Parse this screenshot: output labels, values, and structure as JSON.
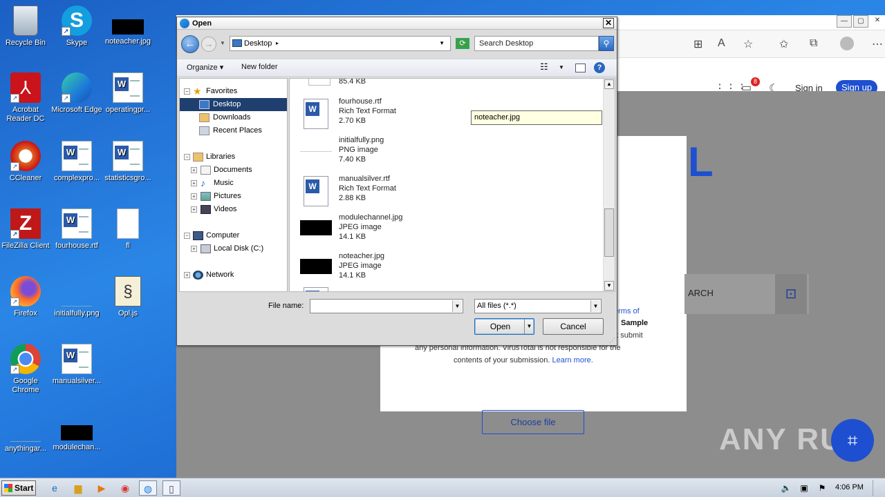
{
  "desktop": {
    "icons": [
      {
        "label": "Recycle Bin"
      },
      {
        "label": "Skype"
      },
      {
        "label": "noteacher.jpg"
      },
      {
        "label": "Acrobat Reader DC"
      },
      {
        "label": "Microsoft Edge"
      },
      {
        "label": "operatingpr..."
      },
      {
        "label": "CCleaner"
      },
      {
        "label": "complexpro..."
      },
      {
        "label": "statisticsgro..."
      },
      {
        "label": "FileZilla Client"
      },
      {
        "label": "fourhouse.rtf"
      },
      {
        "label": "fl"
      },
      {
        "label": "Firefox"
      },
      {
        "label": "initialfully.png"
      },
      {
        "label": "Opl.js"
      },
      {
        "label": "Google Chrome"
      },
      {
        "label": "manualsilver..."
      },
      {
        "label": "anythingar..."
      },
      {
        "label": "modulechan..."
      }
    ]
  },
  "browser": {
    "sign_in": "Sign in",
    "sign_up": "Sign up",
    "notification_count": "8",
    "big_letter": "L",
    "search_partial": "ARCH",
    "terms_text_1": "erms of",
    "terms_text_2": "Sample",
    "terms_text_3": "ot submit",
    "terms_line_4": "any personal information. VirusTotal is not responsible for the",
    "terms_line_5": "contents of your submission.",
    "learn_more": "Learn more.",
    "choose_file": "Choose file",
    "watermark": "ANY RUN"
  },
  "dialog": {
    "title": "Open",
    "close": "✕",
    "path": "Desktop",
    "search_placeholder": "Search Desktop",
    "organize": "Organize",
    "new_folder": "New folder",
    "nav": [
      {
        "label": "Favorites"
      },
      {
        "label": "Desktop"
      },
      {
        "label": "Downloads"
      },
      {
        "label": "Recent Places"
      },
      {
        "label": "Libraries"
      },
      {
        "label": "Documents"
      },
      {
        "label": "Music"
      },
      {
        "label": "Pictures"
      },
      {
        "label": "Videos"
      },
      {
        "label": "Computer"
      },
      {
        "label": "Local Disk (C:)"
      },
      {
        "label": "Network"
      }
    ],
    "files": [
      {
        "name": "",
        "type": "",
        "size": "85.4 KB"
      },
      {
        "name": "fourhouse.rtf",
        "type": "Rich Text Format",
        "size": "2.70 KB"
      },
      {
        "name": "initialfully.png",
        "type": "PNG image",
        "size": "7.40 KB"
      },
      {
        "name": "manualsilver.rtf",
        "type": "Rich Text Format",
        "size": "2.88 KB"
      },
      {
        "name": "modulechannel.jpg",
        "type": "JPEG image",
        "size": "14.1 KB"
      },
      {
        "name": "noteacher.jpg",
        "type": "JPEG image",
        "size": "14.1 KB"
      }
    ],
    "tooltip": "noteacher.jpg",
    "file_name_label": "File name:",
    "file_name_value": "",
    "file_type": "All files (*.*)",
    "open_button": "Open",
    "cancel_button": "Cancel"
  },
  "taskbar": {
    "start": "Start",
    "clock": "4:06 PM"
  }
}
